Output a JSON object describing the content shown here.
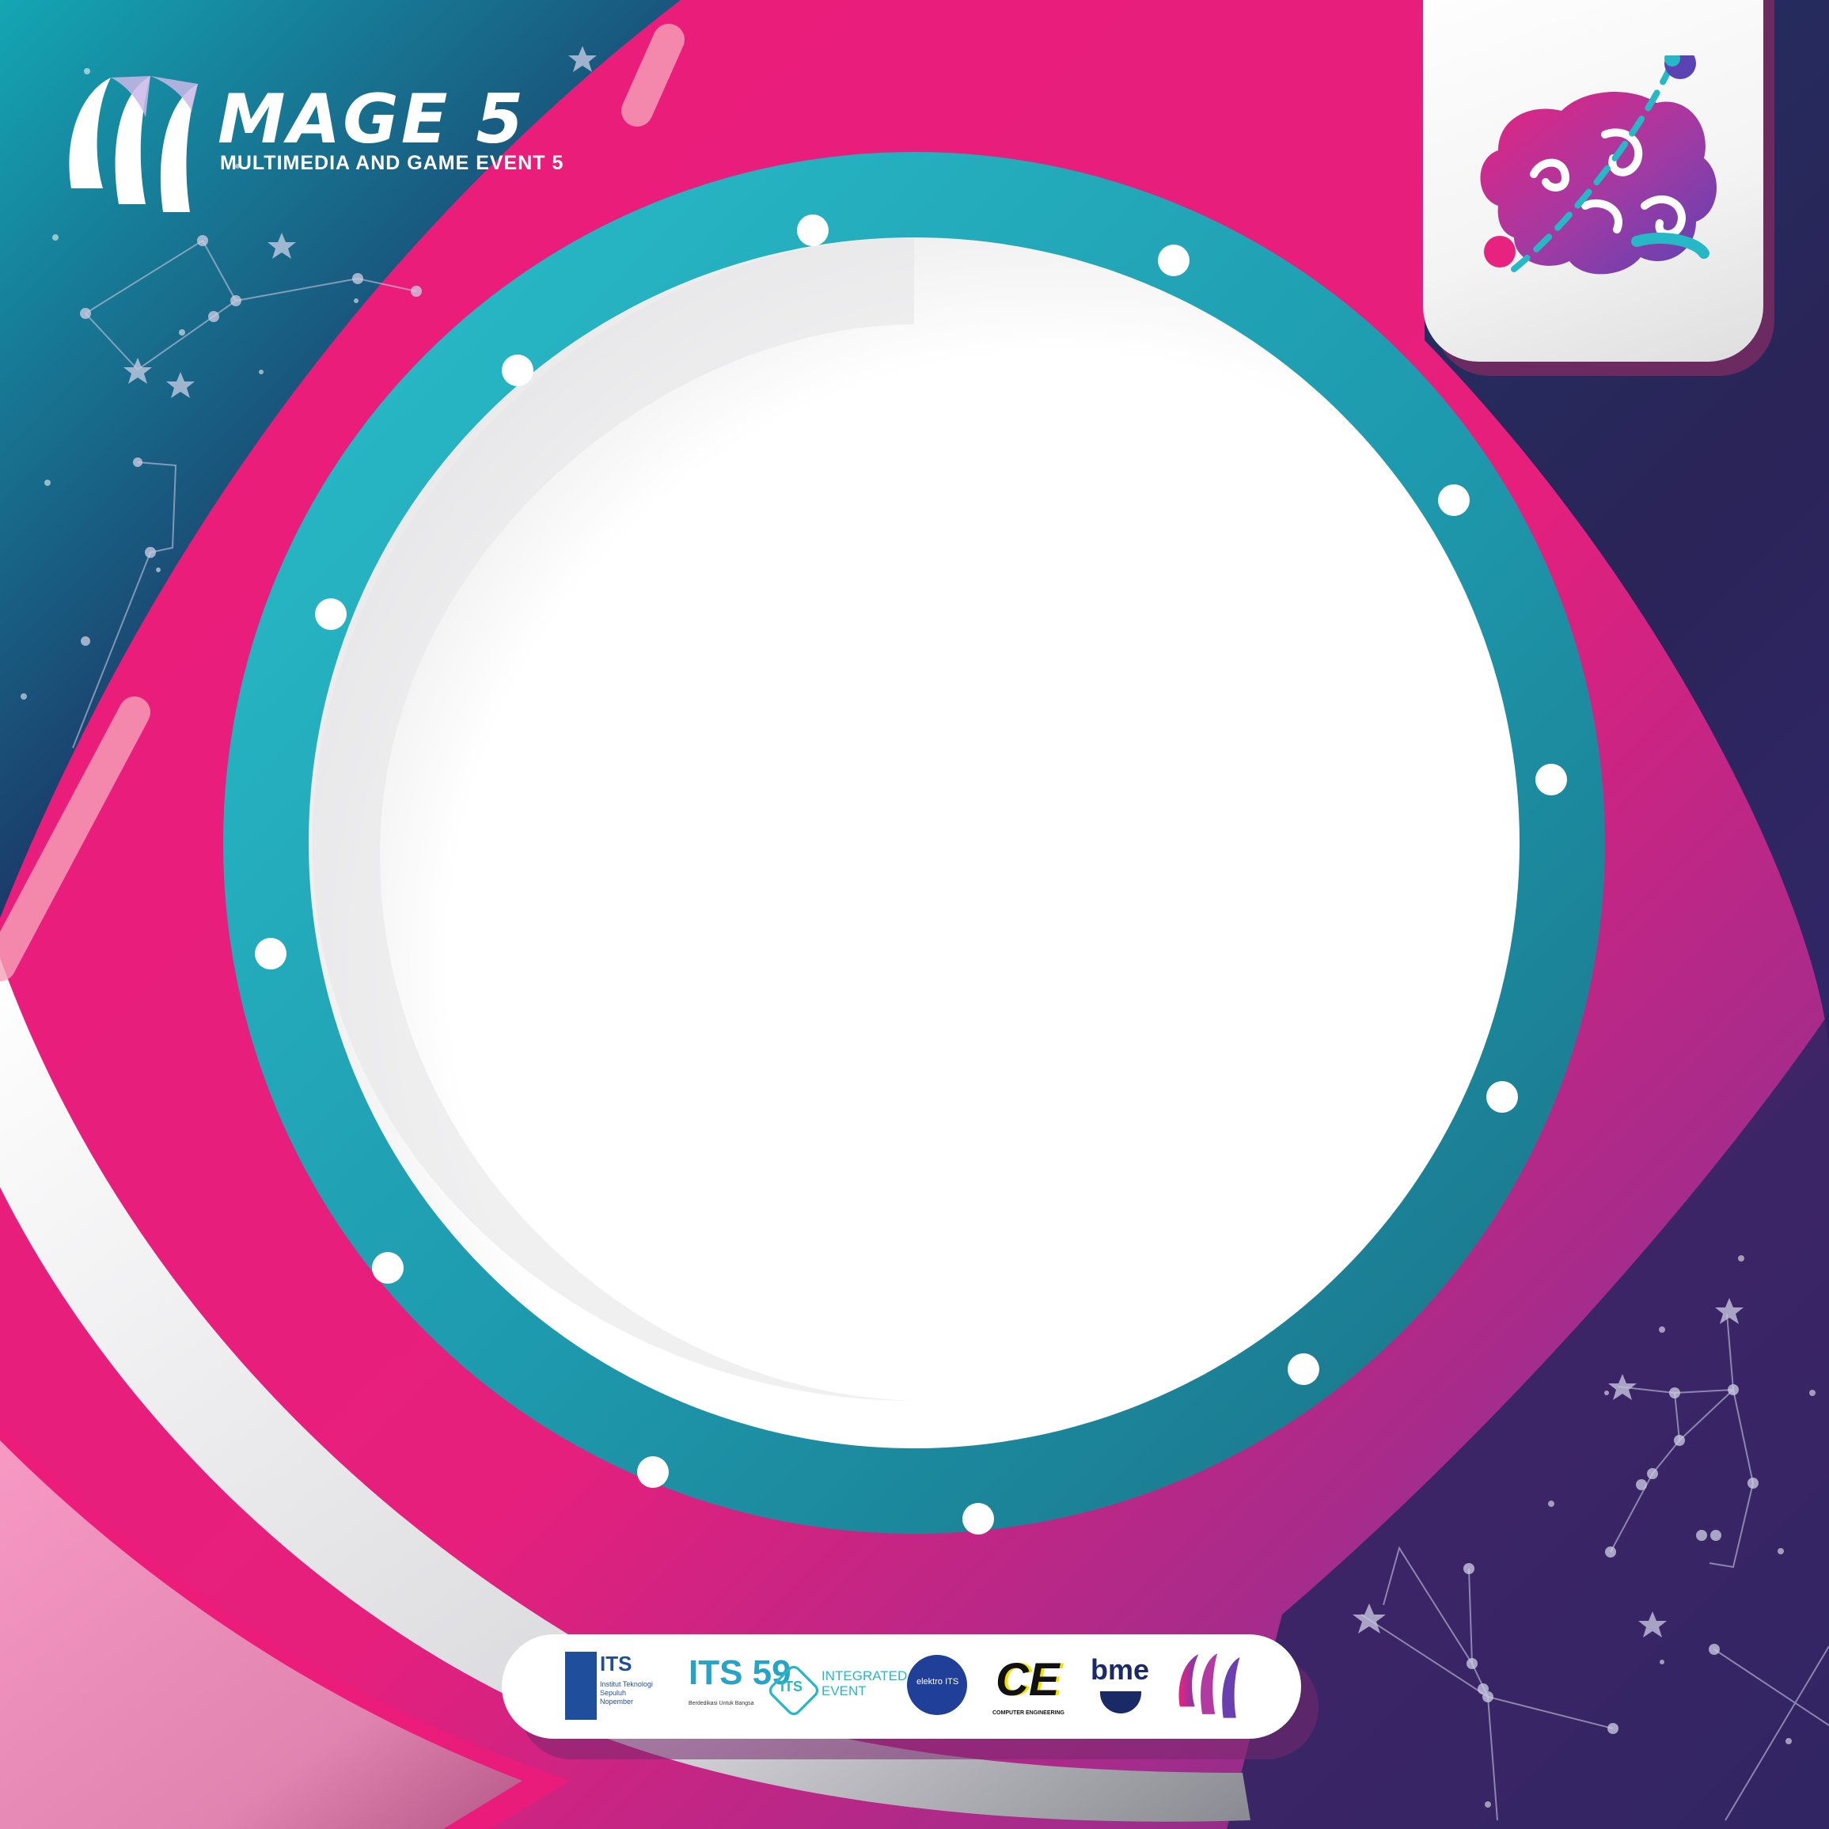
{
  "brand": {
    "title": "MAGE 5",
    "subtitle": "MULTIMEDIA AND GAME EVENT 5"
  },
  "colors": {
    "pink": "#ec1c7a",
    "teal": "#26b8c6",
    "navy": "#1d2c5c",
    "purple": "#5a2b7c",
    "white": "#ffffff"
  },
  "icons": {
    "brain": "brain-icon",
    "mage": "mage-logo-icon"
  },
  "sponsors": [
    {
      "id": "its",
      "label": "ITS",
      "tagline": "Institut Teknologi Sepuluh Nopember"
    },
    {
      "id": "its59",
      "label": "ITS 59",
      "tagline": "Berdedikasi Untuk Bangsa"
    },
    {
      "id": "integrated",
      "label": "ITS",
      "tagline": "INTEGRATED EVENT"
    },
    {
      "id": "elektro",
      "label": "elektro ITS"
    },
    {
      "id": "ce",
      "label": "CE",
      "tagline": "COMPUTER ENGINEERING"
    },
    {
      "id": "bme",
      "label": "bme"
    },
    {
      "id": "mage",
      "label": ""
    }
  ]
}
